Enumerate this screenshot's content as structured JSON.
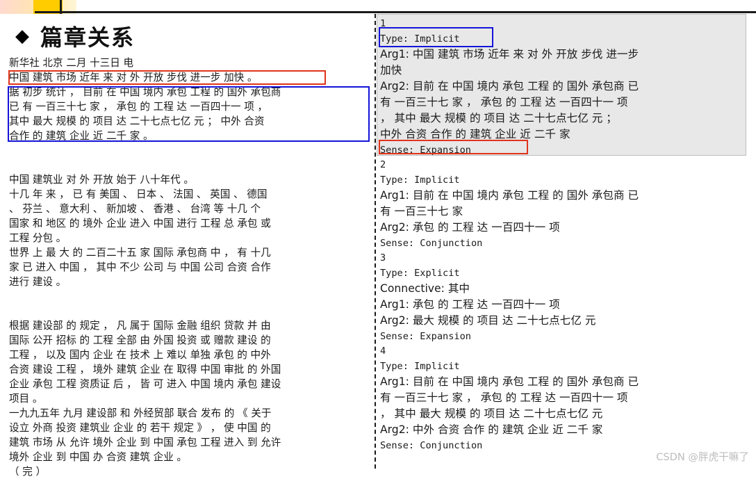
{
  "heading": {
    "bullet": "◆",
    "title": "篇章关系"
  },
  "article": {
    "paragraphs": [
      [
        "新华社 北京 二月 十三日 电",
        "中国 建筑 市场 近年 来 对 外 开放 步伐 进一步 加快 。",
        "据 初步 统计 ， 目前 在 中国 境内 承包 工程 的 国外 承包商",
        "已 有 一百三十七 家 ， 承包 的 工程 达 一百四十一 项 ，",
        "其中 最大 规模 的 项目 达 二十七点七亿 元 ； 中外 合资",
        "合作 的 建筑 企业 近 二千 家 。"
      ],
      [
        "中国 建筑业 对 外 开放 始于 八十年代 。",
        "十几 年 来 ， 已 有 美国 、 日本 、 法国 、 英国 、 德国",
        "、 芬兰 、 意大利 、 新加坡 、 香港 、 台湾 等 十几 个",
        "国家 和 地区 的 境外 企业 进入 中国 进行 工程 总 承包 或",
        "工程 分包 。",
        "世界 上 最 大 的 二百二十五 家 国际 承包商 中 ， 有 十几",
        "家 已 进入 中国 ， 其中 不少 公司 与 中国 公司 合资 合作",
        "进行 建设 。"
      ],
      [
        "根据 建设部 的 规定 ， 凡 属于 国际 金融 组织 贷款 并 由",
        "国际 公开 招标 的 工程 全部 由 外国 投资 或 赠款 建设 的",
        "工程 ， 以及 国内 企业 在 技术 上 难以 单独 承包 的 中外",
        "合资 建设 工程 ， 境外 建筑 企业 在 取得 中国 审批 的 外国",
        "企业 承包 工程 资质证 后 ， 皆 可 进入 中国 境内 承包 建设",
        "项目 。",
        "一九九五年 九月 建设部 和 外经贸部 联合 发布 的 《 关于",
        "设立 外商 投资 建筑业 企业 的 若干 规定 》 ， 使 中国 的",
        "建筑 市场 从 允许 境外 企业 到 中国 承包 工程 进入 到 允许",
        "境外 企业 到 中国 办 合资 建筑 企业 。",
        "（ 完 ）"
      ]
    ]
  },
  "annotations": {
    "lines": [
      [
        "1",
        "num"
      ],
      [
        "Type: Implicit",
        "mono"
      ],
      [
        "Arg1: 中国 建筑 市场 近年 来 对 外 开放 步伐 进一步",
        "mix"
      ],
      [
        "加快",
        "cjk"
      ],
      [
        "Arg2: 目前 在 中国 境内 承包 工程 的 国外 承包商 已",
        "mix"
      ],
      [
        "有 一百三十七 家 ， 承包 的 工程 达 一百四十一 项",
        "cjk"
      ],
      [
        "， 其中 最大 规模 的 项目 达 二十七点七亿 元 ；",
        "cjk"
      ],
      [
        "中外 合资 合作 的 建筑 企业 近 二千 家",
        "cjk"
      ],
      [
        "Sense: Expansion",
        "mono"
      ],
      [
        "2",
        "num"
      ],
      [
        "Type: Implicit",
        "mono"
      ],
      [
        "Arg1: 目前 在 中国 境内 承包 工程 的 国外 承包商 已",
        "mix"
      ],
      [
        "有 一百三十七 家",
        "cjk"
      ],
      [
        "Arg2: 承包 的 工程 达 一百四十一 项",
        "mix"
      ],
      [
        "Sense: Conjunction",
        "mono"
      ],
      [
        "3",
        "num"
      ],
      [
        "Type: Explicit",
        "mono"
      ],
      [
        "Connective: 其中",
        "mix"
      ],
      [
        "Arg1: 承包 的 工程 达 一百四十一 项",
        "mix"
      ],
      [
        "Arg2: 最大 规模 的 项目 达 二十七点七亿 元",
        "mix"
      ],
      [
        "Sense: Expansion",
        "mono"
      ],
      [
        "4",
        "num"
      ],
      [
        "Type: Implicit",
        "mono"
      ],
      [
        "Arg1: 目前 在 中国 境内 承包 工程 的 国外 承包商 已",
        "mix"
      ],
      [
        "有 一百三十七 家 ， 承包 的 工程 达 一百四十一 项",
        "cjk"
      ],
      [
        "， 其中 最大 规模 的 项目 达 二十七点七亿 元",
        "cjk"
      ],
      [
        "Arg2: 中外 合资 合作 的 建筑 企业 近 二千 家",
        "mix"
      ],
      [
        "Sense: Conjunction",
        "mono"
      ]
    ]
  },
  "watermark": "CSDN @胖虎干嘛了",
  "colors": {
    "highlight_red": "#e0341c",
    "highlight_blue": "#1414d8",
    "panel_gray": "#e8e8e8",
    "accent_yellow": "#ffcc00"
  }
}
